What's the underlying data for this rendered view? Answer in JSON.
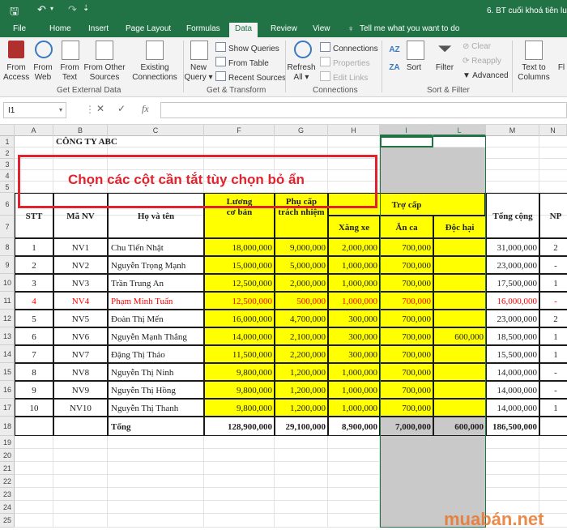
{
  "window": {
    "title": "6. BT cuối khoá tiên lu"
  },
  "tabs": [
    "File",
    "Home",
    "Insert",
    "Page Layout",
    "Formulas",
    "Data",
    "Review",
    "View"
  ],
  "tellme": "Tell me what you want to do",
  "ribbon": {
    "from_access": [
      "From",
      "Access"
    ],
    "from_web": [
      "From",
      "Web"
    ],
    "from_text": [
      "From",
      "Text"
    ],
    "from_other": [
      "From Other",
      "Sources"
    ],
    "existing": [
      "Existing",
      "Connections"
    ],
    "group_external": "Get External Data",
    "new_query": [
      "New",
      "Query"
    ],
    "show_queries": "Show Queries",
    "from_table": "From Table",
    "recent_sources": "Recent Sources",
    "group_transform": "Get & Transform",
    "refresh": [
      "Refresh",
      "All"
    ],
    "connections": "Connections",
    "properties": "Properties",
    "edit_links": "Edit Links",
    "group_connections": "Connections",
    "sort_az": "AZ",
    "sort": "Sort",
    "filter": "Filter",
    "clear": "Clear",
    "reapply": "Reapply",
    "advanced": "Advanced",
    "group_sort": "Sort & Filter",
    "text_to_cols": [
      "Text to",
      "Columns"
    ],
    "flash": "Fl"
  },
  "formula": {
    "namebox": "I1",
    "fx": "fx"
  },
  "columns": [
    "A",
    "B",
    "C",
    "F",
    "G",
    "H",
    "I",
    "L",
    "M",
    "N"
  ],
  "rows": [
    "1",
    "2",
    "3",
    "4",
    "5",
    "6",
    "7",
    "8",
    "9",
    "10",
    "11",
    "12",
    "13",
    "14",
    "15",
    "16",
    "17",
    "18",
    "19",
    "20",
    "21",
    "22",
    "23",
    "24",
    "25"
  ],
  "sheet": {
    "company": "CÔNG TY ABC",
    "headers": {
      "stt": "STT",
      "manv": "Mã NV",
      "hoten": "Họ và tên",
      "luong": [
        "Lương",
        "cơ bản"
      ],
      "phucap": [
        "Phụ cấp",
        "trách nhiệm"
      ],
      "trocap": "Trợ cấp",
      "xangxe": "Xăng xe",
      "anca": "Ăn ca",
      "dochai": "Độc hại",
      "tongcong": "Tổng cộng",
      "np": "NP"
    },
    "rows": [
      {
        "stt": "1",
        "manv": "NV1",
        "hoten": "Chu Tiến Nhật",
        "luong": "18,000,000",
        "phucap": "9,000,000",
        "xang": "2,000,000",
        "anca": "700,000",
        "doc": "",
        "tong": "31,000,000",
        "np": "2"
      },
      {
        "stt": "2",
        "manv": "NV2",
        "hoten": "Nguyễn Trọng Mạnh",
        "luong": "15,000,000",
        "phucap": "5,000,000",
        "xang": "1,000,000",
        "anca": "700,000",
        "doc": "",
        "tong": "23,000,000",
        "np": "-"
      },
      {
        "stt": "3",
        "manv": "NV3",
        "hoten": "Trần Trung An",
        "luong": "12,500,000",
        "phucap": "2,000,000",
        "xang": "1,000,000",
        "anca": "700,000",
        "doc": "",
        "tong": "17,500,000",
        "np": "1"
      },
      {
        "stt": "4",
        "manv": "NV4",
        "hoten": "Phạm Minh Tuấn",
        "luong": "12,500,000",
        "phucap": "500,000",
        "xang": "1,000,000",
        "anca": "700,000",
        "doc": "",
        "tong": "16,000,000",
        "np": "-",
        "red": true
      },
      {
        "stt": "5",
        "manv": "NV5",
        "hoten": "Đoàn Thị Mến",
        "luong": "16,000,000",
        "phucap": "4,700,000",
        "xang": "300,000",
        "anca": "700,000",
        "doc": "",
        "tong": "23,000,000",
        "np": "2"
      },
      {
        "stt": "6",
        "manv": "NV6",
        "hoten": "Nguyễn Mạnh Thắng",
        "luong": "14,000,000",
        "phucap": "2,100,000",
        "xang": "300,000",
        "anca": "700,000",
        "doc": "600,000",
        "tong": "18,500,000",
        "np": "1"
      },
      {
        "stt": "7",
        "manv": "NV7",
        "hoten": "Đặng Thị Thảo",
        "luong": "11,500,000",
        "phucap": "2,200,000",
        "xang": "300,000",
        "anca": "700,000",
        "doc": "",
        "tong": "15,500,000",
        "np": "1"
      },
      {
        "stt": "8",
        "manv": "NV8",
        "hoten": "Nguyễn Thị Ninh",
        "luong": "9,800,000",
        "phucap": "1,200,000",
        "xang": "1,000,000",
        "anca": "700,000",
        "doc": "",
        "tong": "14,000,000",
        "np": "-"
      },
      {
        "stt": "9",
        "manv": "NV9",
        "hoten": "Nguyễn Thị Hồng",
        "luong": "9,800,000",
        "phucap": "1,200,000",
        "xang": "1,000,000",
        "anca": "700,000",
        "doc": "",
        "tong": "14,000,000",
        "np": "-"
      },
      {
        "stt": "10",
        "manv": "NV10",
        "hoten": "Nguyễn Thị Thanh",
        "luong": "9,800,000",
        "phucap": "1,200,000",
        "xang": "1,000,000",
        "anca": "700,000",
        "doc": "",
        "tong": "14,000,000",
        "np": "1"
      }
    ],
    "total": {
      "label": "Tổng",
      "luong": "128,900,000",
      "phucap": "29,100,000",
      "xang": "8,900,000",
      "anca": "7,000,000",
      "doc": "600,000",
      "tong": "186,500,000"
    }
  },
  "callout": "Chọn các cột cần tắt tùy chọn bỏ ẩn",
  "watermark": "muabán.net",
  "colors": {
    "excel_green": "#217346",
    "highlight": "#ffff00",
    "callout_red": "#e0232e",
    "watermark": "#e8762b"
  }
}
